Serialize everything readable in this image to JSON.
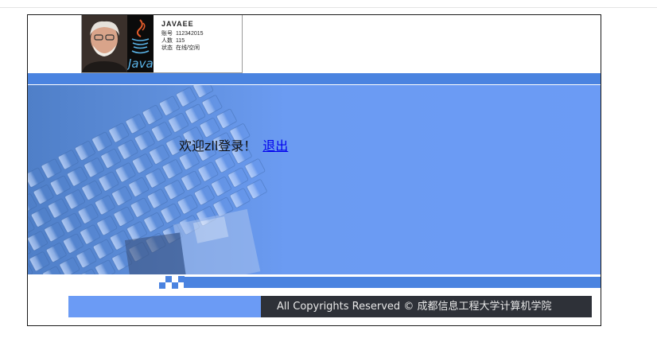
{
  "profile": {
    "name": "JAVAEE",
    "rows": [
      {
        "label": "账号",
        "value": "112342015"
      },
      {
        "label": "人数",
        "value": "115"
      },
      {
        "label": "状态",
        "value": "在线/空闲"
      }
    ],
    "logo_text": "Java"
  },
  "banner": {
    "welcome_text": "欢迎zll登录！",
    "logout_label": "退出"
  },
  "footer": {
    "copyright": "All Copyrights Reserved © 成都信息工程大学计算机学院"
  },
  "colors": {
    "accent_blue": "#4a83e0",
    "light_blue": "#6b9bf5",
    "footer_dark": "#2e3138",
    "link": "#0000ee"
  }
}
